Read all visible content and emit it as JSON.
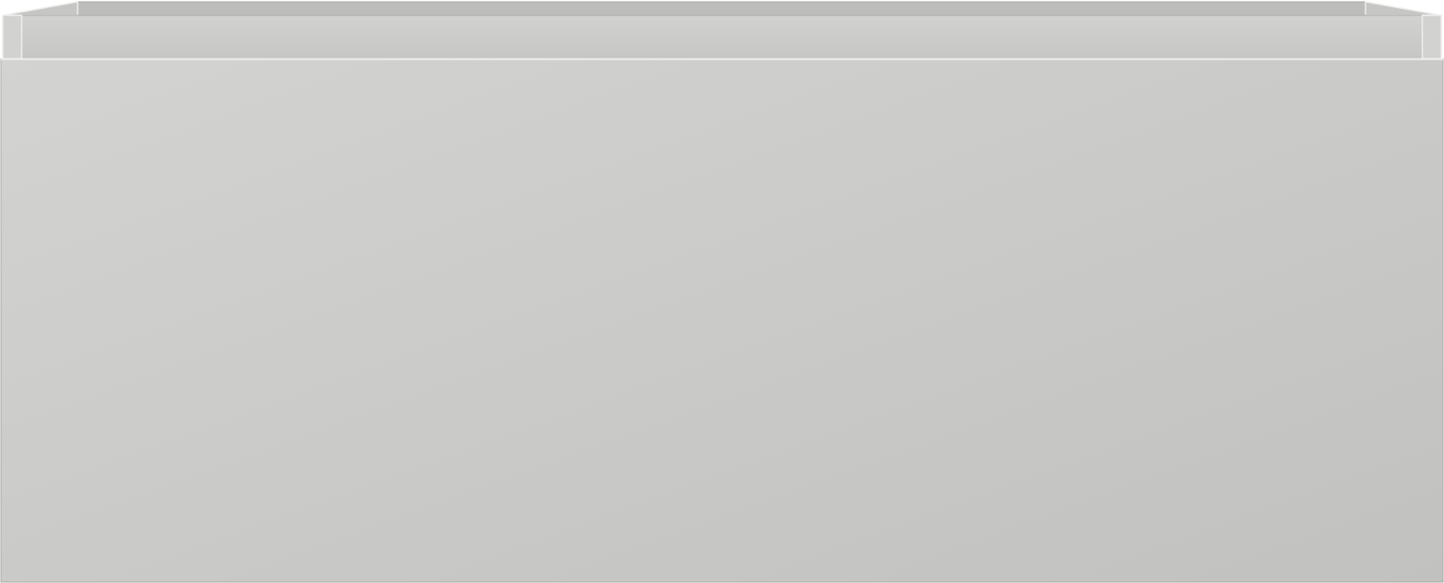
{
  "object": {
    "kind": "drawer-box",
    "colors": {
      "front_light": "#d3d3d1",
      "front_dark": "#c1c1bf",
      "rim_light": "#d2d2d0",
      "rim_dark": "#c6c6c4",
      "edge_highlight": "#eeeeec",
      "outline": "#a9a9a7",
      "inner_wall": "#bdbdbb"
    }
  }
}
